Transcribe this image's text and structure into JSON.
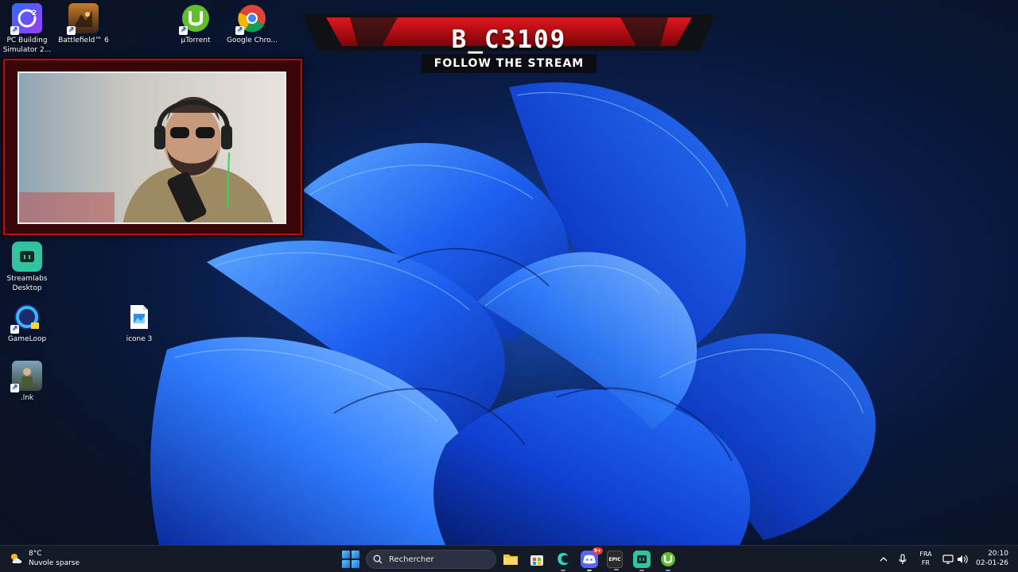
{
  "desktop": {
    "icons": [
      {
        "label": "PC Building Simulator 2...",
        "icon": "pc-building-simulator-icon"
      },
      {
        "label": "Battlefield™ 6",
        "icon": "battlefield-icon"
      },
      {
        "label": "µTorrent",
        "icon": "utorrent-icon"
      },
      {
        "label": "Google Chro...",
        "icon": "google-chrome-icon"
      },
      {
        "label": "Streamlabs Desktop",
        "icon": "streamlabs-icon"
      },
      {
        "label": "GameLoop",
        "icon": "gameloop-icon"
      },
      {
        "label": "icone 3",
        "icon": "image-file-icon"
      },
      {
        "label": ".lnk",
        "icon": "pubg-shortcut-icon"
      }
    ]
  },
  "overlay": {
    "streamer_name": "B_C3109",
    "tagline": "FOLLOW THE STREAM"
  },
  "taskbar": {
    "weather": {
      "temperature": "8°C",
      "condition": "Nuvole sparse"
    },
    "search_placeholder": "Rechercher",
    "apps": [
      "file-explorer-icon",
      "microsoft-store-icon",
      "browser-icon",
      "discord-icon",
      "epic-games-icon",
      "streamlabs-icon",
      "utorrent-icon"
    ],
    "discord_badge": "9+",
    "epic_label": "EPIC",
    "language": {
      "line1": "FRA",
      "line2": "FR"
    },
    "clock": {
      "time": "20:10",
      "date": "02-01-26"
    }
  },
  "colors": {
    "accent_red": "#b10f16",
    "taskbar_bg": "#141a26",
    "wallpaper_blue": "#1b5bd6"
  }
}
